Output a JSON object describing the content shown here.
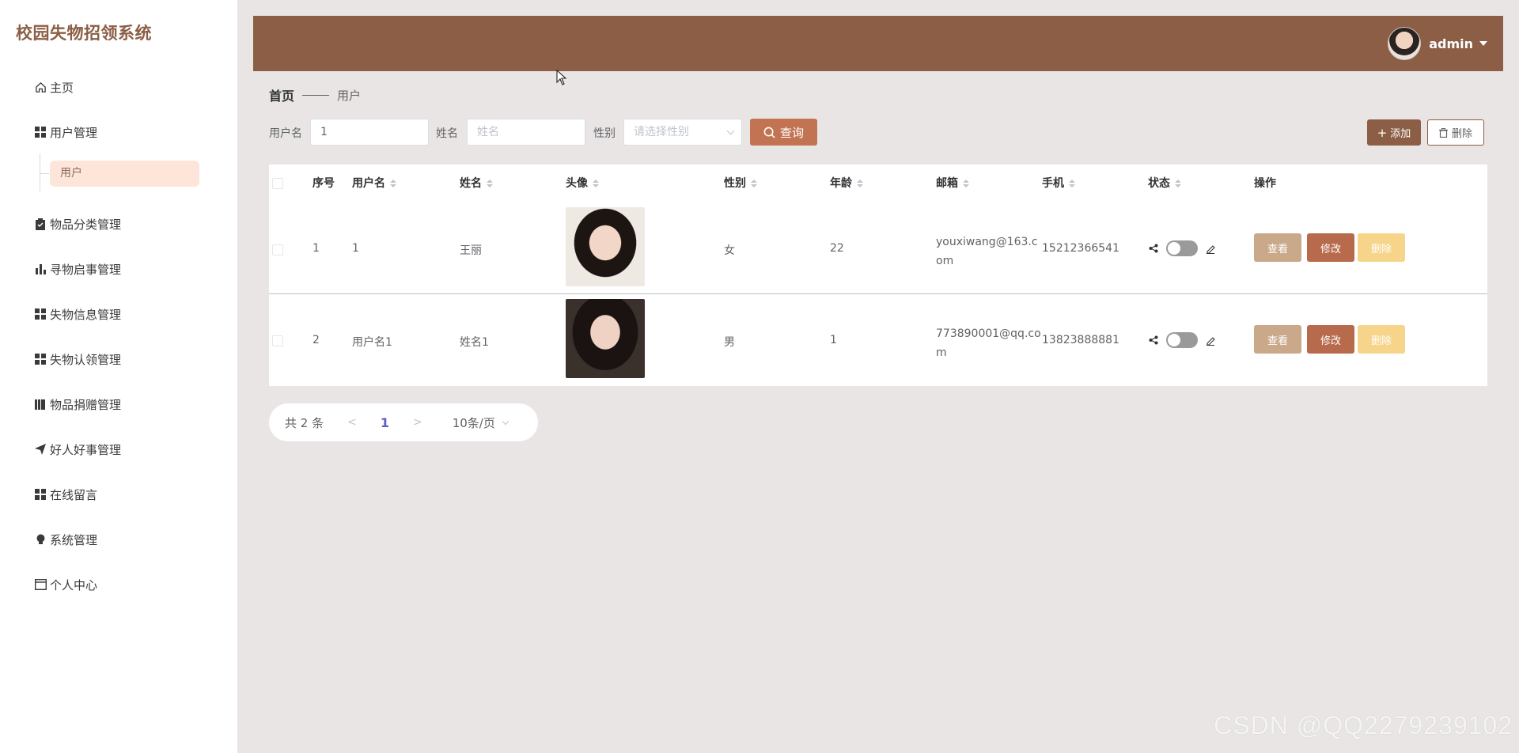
{
  "app": {
    "title": "校园失物招领系统"
  },
  "sidebar": {
    "items": [
      {
        "label": "主页",
        "icon": "home-icon"
      },
      {
        "label": "用户管理",
        "icon": "grid-icon"
      },
      {
        "label": "物品分类管理",
        "icon": "clipboard-icon"
      },
      {
        "label": "寻物启事管理",
        "icon": "bar-chart-icon"
      },
      {
        "label": "失物信息管理",
        "icon": "grid-icon"
      },
      {
        "label": "失物认领管理",
        "icon": "grid-icon"
      },
      {
        "label": "物品捐赠管理",
        "icon": "book-icon"
      },
      {
        "label": "好人好事管理",
        "icon": "send-icon"
      },
      {
        "label": "在线留言",
        "icon": "grid-icon"
      },
      {
        "label": "系统管理",
        "icon": "bulb-icon"
      },
      {
        "label": "个人中心",
        "icon": "window-icon"
      }
    ],
    "sub_item": "用户"
  },
  "header": {
    "user_name": "admin"
  },
  "breadcrumb": {
    "home": "首页",
    "current": "用户"
  },
  "search": {
    "username_label": "用户名",
    "username_value": "1",
    "name_label": "姓名",
    "name_placeholder": "姓名",
    "gender_label": "性别",
    "gender_placeholder": "请选择性别",
    "search_button": "查询",
    "add_button": "添加",
    "delete_button": "删除"
  },
  "table": {
    "columns": [
      "序号",
      "用户名",
      "姓名",
      "头像",
      "性别",
      "年龄",
      "邮箱",
      "手机",
      "状态",
      "操作"
    ],
    "rows": [
      {
        "index": "1",
        "username": "1",
        "name": "王丽",
        "gender": "女",
        "age": "22",
        "email": "youxiwang@163.com",
        "phone": "15212366541"
      },
      {
        "index": "2",
        "username": "用户名1",
        "name": "姓名1",
        "gender": "男",
        "age": "1",
        "email": "773890001@qq.com",
        "phone": "13823888881"
      }
    ],
    "actions": {
      "view": "查看",
      "edit": "修改",
      "delete": "删除"
    }
  },
  "pagination": {
    "total": "共 2 条",
    "prev": "<",
    "current": "1",
    "next": ">",
    "page_size": "10条/页"
  },
  "watermark": "CSDN @QQ2279239102",
  "colors": {
    "brand": "#8b5e45",
    "search_button": "#c27452",
    "active_sub": "#fde5da",
    "view": "#c9a98a",
    "edit": "#b76a4c",
    "delete": "#f6d48a"
  }
}
